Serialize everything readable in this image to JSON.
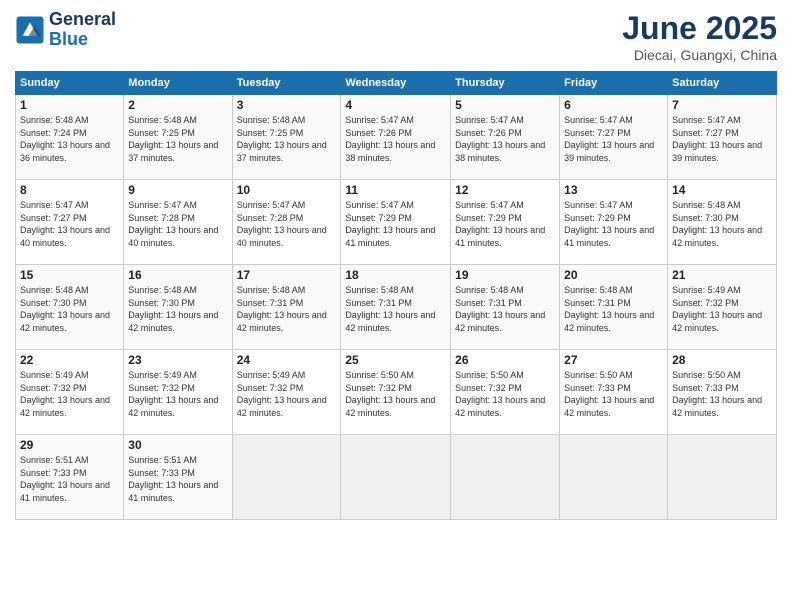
{
  "header": {
    "logo_line1": "General",
    "logo_line2": "Blue",
    "month_title": "June 2025",
    "location": "Diecai, Guangxi, China"
  },
  "weekdays": [
    "Sunday",
    "Monday",
    "Tuesday",
    "Wednesday",
    "Thursday",
    "Friday",
    "Saturday"
  ],
  "weeks": [
    [
      {
        "day": "1",
        "sunrise": "Sunrise: 5:48 AM",
        "sunset": "Sunset: 7:24 PM",
        "daylight": "Daylight: 13 hours and 36 minutes."
      },
      {
        "day": "2",
        "sunrise": "Sunrise: 5:48 AM",
        "sunset": "Sunset: 7:25 PM",
        "daylight": "Daylight: 13 hours and 37 minutes."
      },
      {
        "day": "3",
        "sunrise": "Sunrise: 5:48 AM",
        "sunset": "Sunset: 7:25 PM",
        "daylight": "Daylight: 13 hours and 37 minutes."
      },
      {
        "day": "4",
        "sunrise": "Sunrise: 5:47 AM",
        "sunset": "Sunset: 7:26 PM",
        "daylight": "Daylight: 13 hours and 38 minutes."
      },
      {
        "day": "5",
        "sunrise": "Sunrise: 5:47 AM",
        "sunset": "Sunset: 7:26 PM",
        "daylight": "Daylight: 13 hours and 38 minutes."
      },
      {
        "day": "6",
        "sunrise": "Sunrise: 5:47 AM",
        "sunset": "Sunset: 7:27 PM",
        "daylight": "Daylight: 13 hours and 39 minutes."
      },
      {
        "day": "7",
        "sunrise": "Sunrise: 5:47 AM",
        "sunset": "Sunset: 7:27 PM",
        "daylight": "Daylight: 13 hours and 39 minutes."
      }
    ],
    [
      {
        "day": "8",
        "sunrise": "Sunrise: 5:47 AM",
        "sunset": "Sunset: 7:27 PM",
        "daylight": "Daylight: 13 hours and 40 minutes."
      },
      {
        "day": "9",
        "sunrise": "Sunrise: 5:47 AM",
        "sunset": "Sunset: 7:28 PM",
        "daylight": "Daylight: 13 hours and 40 minutes."
      },
      {
        "day": "10",
        "sunrise": "Sunrise: 5:47 AM",
        "sunset": "Sunset: 7:28 PM",
        "daylight": "Daylight: 13 hours and 40 minutes."
      },
      {
        "day": "11",
        "sunrise": "Sunrise: 5:47 AM",
        "sunset": "Sunset: 7:29 PM",
        "daylight": "Daylight: 13 hours and 41 minutes."
      },
      {
        "day": "12",
        "sunrise": "Sunrise: 5:47 AM",
        "sunset": "Sunset: 7:29 PM",
        "daylight": "Daylight: 13 hours and 41 minutes."
      },
      {
        "day": "13",
        "sunrise": "Sunrise: 5:47 AM",
        "sunset": "Sunset: 7:29 PM",
        "daylight": "Daylight: 13 hours and 41 minutes."
      },
      {
        "day": "14",
        "sunrise": "Sunrise: 5:48 AM",
        "sunset": "Sunset: 7:30 PM",
        "daylight": "Daylight: 13 hours and 42 minutes."
      }
    ],
    [
      {
        "day": "15",
        "sunrise": "Sunrise: 5:48 AM",
        "sunset": "Sunset: 7:30 PM",
        "daylight": "Daylight: 13 hours and 42 minutes."
      },
      {
        "day": "16",
        "sunrise": "Sunrise: 5:48 AM",
        "sunset": "Sunset: 7:30 PM",
        "daylight": "Daylight: 13 hours and 42 minutes."
      },
      {
        "day": "17",
        "sunrise": "Sunrise: 5:48 AM",
        "sunset": "Sunset: 7:31 PM",
        "daylight": "Daylight: 13 hours and 42 minutes."
      },
      {
        "day": "18",
        "sunrise": "Sunrise: 5:48 AM",
        "sunset": "Sunset: 7:31 PM",
        "daylight": "Daylight: 13 hours and 42 minutes."
      },
      {
        "day": "19",
        "sunrise": "Sunrise: 5:48 AM",
        "sunset": "Sunset: 7:31 PM",
        "daylight": "Daylight: 13 hours and 42 minutes."
      },
      {
        "day": "20",
        "sunrise": "Sunrise: 5:48 AM",
        "sunset": "Sunset: 7:31 PM",
        "daylight": "Daylight: 13 hours and 42 minutes."
      },
      {
        "day": "21",
        "sunrise": "Sunrise: 5:49 AM",
        "sunset": "Sunset: 7:32 PM",
        "daylight": "Daylight: 13 hours and 42 minutes."
      }
    ],
    [
      {
        "day": "22",
        "sunrise": "Sunrise: 5:49 AM",
        "sunset": "Sunset: 7:32 PM",
        "daylight": "Daylight: 13 hours and 42 minutes."
      },
      {
        "day": "23",
        "sunrise": "Sunrise: 5:49 AM",
        "sunset": "Sunset: 7:32 PM",
        "daylight": "Daylight: 13 hours and 42 minutes."
      },
      {
        "day": "24",
        "sunrise": "Sunrise: 5:49 AM",
        "sunset": "Sunset: 7:32 PM",
        "daylight": "Daylight: 13 hours and 42 minutes."
      },
      {
        "day": "25",
        "sunrise": "Sunrise: 5:50 AM",
        "sunset": "Sunset: 7:32 PM",
        "daylight": "Daylight: 13 hours and 42 minutes."
      },
      {
        "day": "26",
        "sunrise": "Sunrise: 5:50 AM",
        "sunset": "Sunset: 7:32 PM",
        "daylight": "Daylight: 13 hours and 42 minutes."
      },
      {
        "day": "27",
        "sunrise": "Sunrise: 5:50 AM",
        "sunset": "Sunset: 7:33 PM",
        "daylight": "Daylight: 13 hours and 42 minutes."
      },
      {
        "day": "28",
        "sunrise": "Sunrise: 5:50 AM",
        "sunset": "Sunset: 7:33 PM",
        "daylight": "Daylight: 13 hours and 42 minutes."
      }
    ],
    [
      {
        "day": "29",
        "sunrise": "Sunrise: 5:51 AM",
        "sunset": "Sunset: 7:33 PM",
        "daylight": "Daylight: 13 hours and 41 minutes."
      },
      {
        "day": "30",
        "sunrise": "Sunrise: 5:51 AM",
        "sunset": "Sunset: 7:33 PM",
        "daylight": "Daylight: 13 hours and 41 minutes."
      },
      null,
      null,
      null,
      null,
      null
    ]
  ]
}
